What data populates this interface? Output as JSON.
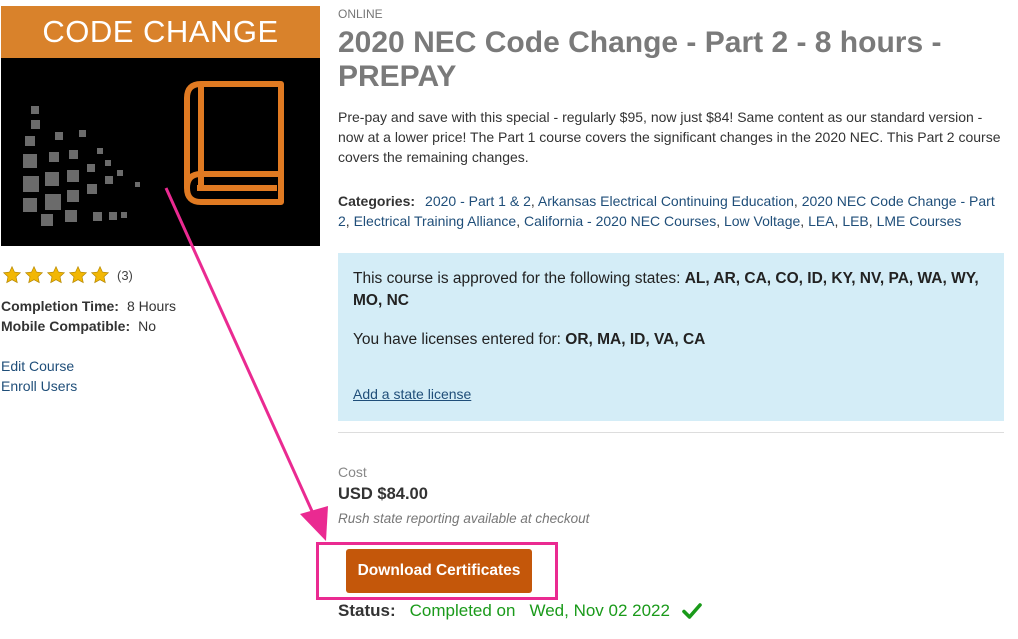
{
  "thumbnail": {
    "banner_text": "CODE CHANGE",
    "banner_color": "#d9822b",
    "book_color": "#e07a22"
  },
  "rating": {
    "stars": 5,
    "max": 5,
    "count_text": "(3)",
    "star_color": "#f2b705"
  },
  "details": {
    "completion_label": "Completion Time:",
    "completion_value": "8 Hours",
    "mobile_label": "Mobile Compatible:",
    "mobile_value": "No"
  },
  "side_links": {
    "edit": "Edit Course",
    "enroll": "Enroll Users"
  },
  "course": {
    "type": "ONLINE",
    "title": "2020 NEC Code Change - Part 2 - 8 hours - PREPAY",
    "description": "Pre-pay and save with this special - regularly $95, now just $84! Same content as our standard version - now at a lower price! The Part 1 course covers the significant changes in the 2020 NEC. This Part 2 course covers the remaining changes.",
    "categories_label": "Categories:",
    "categories": [
      "2020 - Part 1 & 2",
      "Arkansas Electrical Continuing Education",
      "2020 NEC Code Change - Part 2",
      "Electrical Training Alliance",
      "California - 2020 NEC Courses",
      "Low Voltage",
      "LEA",
      "LEB",
      "LME Courses"
    ]
  },
  "states": {
    "approved_prefix": "This course is approved for the following states:",
    "approved_states": "AL, AR, CA, CO, ID, KY, NV, PA, WA, WY, MO, NC",
    "licenses_prefix": "You have licenses entered for:",
    "license_states": "OR, MA, ID, VA, CA",
    "add_link": "Add a state license",
    "box_color": "#d4edf7"
  },
  "cost": {
    "label": "Cost",
    "value": "USD $84.00",
    "note": "Rush state reporting available at checkout"
  },
  "actions": {
    "download_label": "Download Certificates",
    "button_color": "#c4570a"
  },
  "status": {
    "label": "Status:",
    "value": "Completed on",
    "date": "Wed, Nov 02 2022",
    "color": "#1a9a1a"
  },
  "annotation": {
    "color": "#ea2a91"
  }
}
